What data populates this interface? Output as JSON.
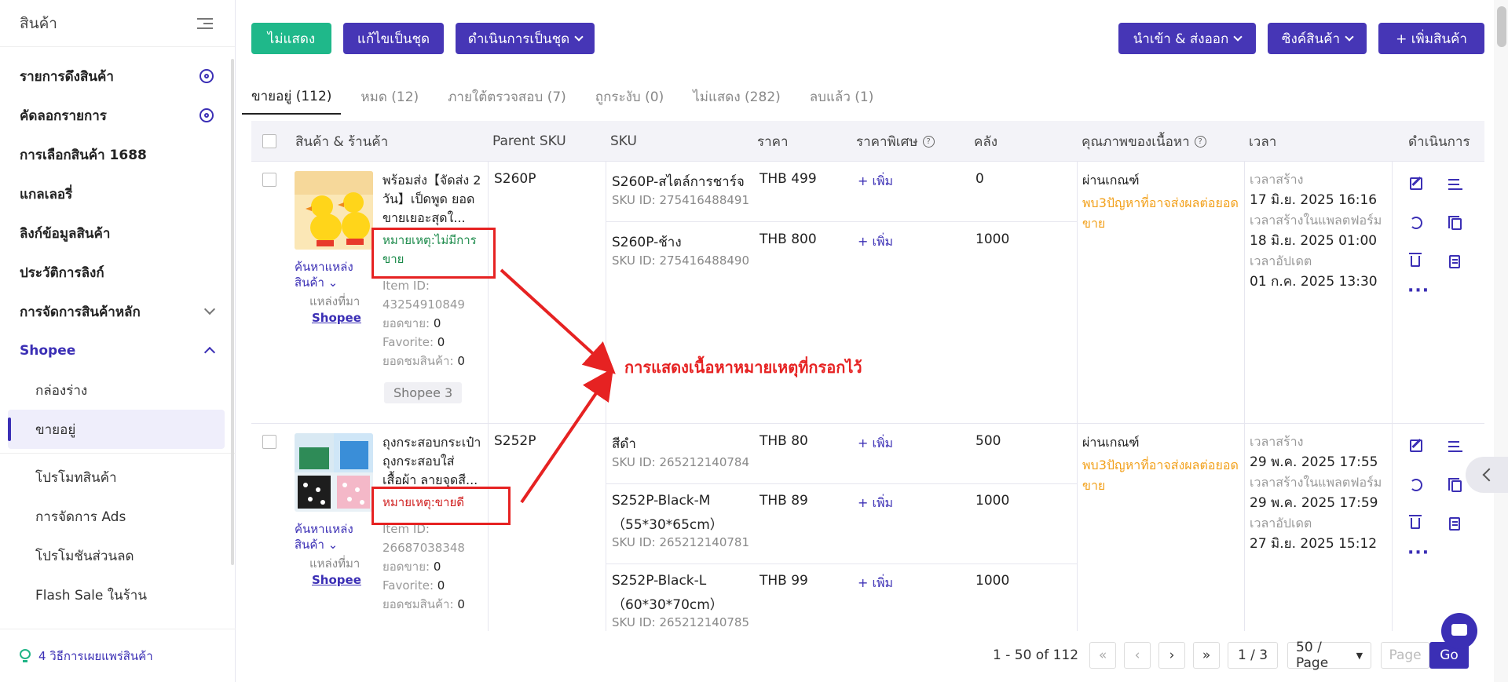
{
  "sidebar": {
    "title": "สินค้า",
    "items": [
      {
        "label": "รายการดึงสินค้า"
      },
      {
        "label": "คัดลอกรายการ"
      },
      {
        "label": "การเลือกสินค้า 1688"
      },
      {
        "label": "แกลเลอรี่"
      },
      {
        "label": "ลิงก์ข้อมูลสินค้า"
      },
      {
        "label": "ประวัติการลิงก์"
      },
      {
        "label": "การจัดการสินค้าหลัก"
      },
      {
        "label": "Shopee"
      }
    ],
    "sub": [
      "กล่องร่าง",
      "ขายอยู่",
      "โปรโมทสินค้า",
      "การจัดการ Ads",
      "โปรโมชันส่วนลด",
      "Flash Sale ในร้าน"
    ],
    "footer": "4 วิธีการเผยแพร่สินค้า"
  },
  "toolbar": {
    "hide": "ไม่แสดง",
    "batch_edit": "แก้ไขเป็นชุด",
    "batch_action": "ดำเนินการเป็นชุด",
    "import_export": "นำเข้า & ส่งออก",
    "sync": "ซิงค์สินค้า",
    "add": "+ เพิ่มสินค้า"
  },
  "tabs": [
    "ขายอยู่ (112)",
    "หมด (12)",
    "ภายใต้ตรวจสอบ (7)",
    "ถูกระงับ (0)",
    "ไม่แสดง (282)",
    "ลบแล้ว (1)"
  ],
  "table": {
    "headers": {
      "product": "สินค้า & ร้านค้า",
      "parent_sku": "Parent SKU",
      "sku": "SKU",
      "price": "ราคา",
      "special": "ราคาพิเศษ",
      "stock": "คลัง",
      "quality": "คุณภาพของเนื้อหา",
      "time": "เวลา",
      "action": "ดำเนินการ"
    },
    "rows": [
      {
        "name": "พร้อมส่ง【จัดส่ง 2 วัน】เป็ดพูด ยอดขายเยอะสุดใ...",
        "note": "หมายเหตุ:ไม่มีการขาย",
        "item_id_label": "Item ID:",
        "item_id": "43254910849",
        "sold_label": "ยอดขาย:",
        "sold": "0",
        "fav_label": "Favorite:",
        "fav": "0",
        "views_label": "ยอดชมสินค้า:",
        "views": "0",
        "find_source": "ค้นหาแหล่งสินค้า",
        "source_label": "แหล่งที่มา",
        "source": "Shopee",
        "shop_tag": "Shopee 3",
        "parent_sku": "S260P",
        "skus": [
          {
            "sku": "S260P-สไตล์การชาร์จ",
            "sku_id": "SKU ID: 275416488491",
            "price": "THB 499",
            "special": "+ เพิ่ม",
            "stock": "0"
          },
          {
            "sku": "S260P-ช้าง",
            "sku_id": "SKU ID: 275416488490",
            "price": "THB 800",
            "special": "+ เพิ่ม",
            "stock": "1000"
          }
        ],
        "quality": "ผ่านเกณฑ์",
        "warn": "พบ3ปัญหาที่อาจส่งผลต่อยอดขาย",
        "created_label": "เวลาสร้าง",
        "created": "17 มิ.ย. 2025 16:16",
        "platform_label": "เวลาสร้างในแพลตฟอร์ม",
        "platform": "18 มิ.ย. 2025 01:00",
        "updated_label": "เวลาอัปเดต",
        "updated": "01 ก.ค. 2025 13:30"
      },
      {
        "name": "ถุงกระสอบกระเป๋า ถุงกระสอบใส่เสื้อผ้า ลายจุดสี...",
        "note": "หมายเหตุ:ขายดี",
        "item_id_label": "Item ID:",
        "item_id": "26687038348",
        "sold_label": "ยอดขาย:",
        "sold": "0",
        "fav_label": "Favorite:",
        "fav": "0",
        "views_label": "ยอดชมสินค้า:",
        "views": "0",
        "find_source": "ค้นหาแหล่งสินค้า",
        "source_label": "แหล่งที่มา",
        "source": "Shopee",
        "parent_sku": "S252P",
        "skus": [
          {
            "sku": "สีดำ",
            "sku_id": "SKU ID: 265212140784",
            "price": "THB 80",
            "special": "+ เพิ่ม",
            "stock": "500"
          },
          {
            "sku": "S252P-Black-M",
            "sku2": "（55*30*65cm）",
            "sku_id": "SKU ID: 265212140781",
            "price": "THB 89",
            "special": "+ เพิ่ม",
            "stock": "1000"
          },
          {
            "sku": "S252P-Black-L",
            "sku2": "（60*30*70cm）",
            "sku_id": "SKU ID: 265212140785",
            "price": "THB 99",
            "special": "+ เพิ่ม",
            "stock": "1000"
          }
        ],
        "quality": "ผ่านเกณฑ์",
        "warn": "พบ3ปัญหาที่อาจส่งผลต่อยอดขาย",
        "created_label": "เวลาสร้าง",
        "created": "29 พ.ค. 2025 17:55",
        "platform_label": "เวลาสร้างในแพลตฟอร์ม",
        "platform": "29 พ.ค. 2025 17:59",
        "updated_label": "เวลาอัปเดต",
        "updated": "27 มิ.ย. 2025 15:12"
      }
    ]
  },
  "annotation": "การแสดงเนื้อหาหมายเหตุที่กรอกไว้",
  "pagination": {
    "range": "1 - 50 of 112",
    "page": "1 / 3",
    "per_page": "50 / Page",
    "page_placeholder": "Page",
    "go": "Go"
  },
  "colors": {
    "accent": "#3b2fb5",
    "green": "#1fb88a",
    "annotation": "#e62222",
    "warn": "#f2a01a"
  }
}
